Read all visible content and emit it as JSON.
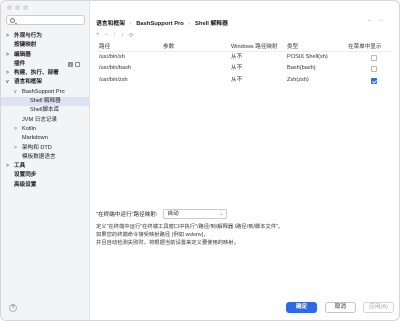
{
  "sidebar": {
    "items": [
      {
        "label": "外观与行为",
        "bold": true,
        "chev": ">"
      },
      {
        "label": "按键映射",
        "bold": true,
        "chev": ""
      },
      {
        "label": "编辑器",
        "bold": true,
        "chev": ">"
      },
      {
        "label": "插件",
        "bold": true,
        "chev": ""
      },
      {
        "label": "构建、执行、部署",
        "bold": true,
        "chev": ">"
      },
      {
        "label": "语言和框架",
        "bold": true,
        "chev": "v"
      },
      {
        "label": "BashSupport Pro",
        "bold": false,
        "chev": "v"
      },
      {
        "label": "Shell 解释器",
        "bold": false,
        "chev": ""
      },
      {
        "label": "Shell脚本库",
        "bold": false,
        "chev": ""
      },
      {
        "label": "JVM 日志记录",
        "bold": false,
        "chev": ""
      },
      {
        "label": "Kotlin",
        "bold": false,
        "chev": ">"
      },
      {
        "label": "Markdown",
        "bold": false,
        "chev": ""
      },
      {
        "label": "架构和 DTD",
        "bold": false,
        "chev": ">"
      },
      {
        "label": "模板数据语言",
        "bold": false,
        "chev": ""
      },
      {
        "label": "工具",
        "bold": true,
        "chev": ">"
      },
      {
        "label": "设置同步",
        "bold": true,
        "chev": ""
      },
      {
        "label": "高级设置",
        "bold": true,
        "chev": ""
      }
    ],
    "help": "?"
  },
  "breadcrumb": {
    "a": "语言和框架",
    "b": "BashSupport Pro",
    "c": "Shell 解释器",
    "sep": "›"
  },
  "toolbar": {
    "icons": [
      "add-icon",
      "remove-icon",
      "move-up-icon",
      "move-down-icon",
      "refresh-icon"
    ]
  },
  "table": {
    "headers": [
      "路径",
      "参数",
      "Windows 路径映射",
      "类型",
      "在菜单中显示"
    ],
    "rows": [
      {
        "path": "/usr/bin/sh",
        "args": "",
        "mapping": "从不",
        "type": "POSIX Shell(sh)",
        "show": false
      },
      {
        "path": "/usr/bin/bash",
        "args": "",
        "mapping": "从不",
        "type": "Bash(bash)",
        "show": false
      },
      {
        "path": "/usr/bin/zsh",
        "args": "",
        "mapping": "从不",
        "type": "Zsh(zsh)",
        "show": true
      }
    ]
  },
  "mapping": {
    "label": "\"在终端中运行\"路径映射:",
    "value": "自动"
  },
  "description": {
    "line1": "定义\"在终端中运行\"在终端工具窗口中执行\"/路径/到/解释器 /路径/到/脚本文件\"。",
    "line2": "如果您的终端命令接受映射路径 (例如 wslenv)，",
    "line3": "并且自动检测失败时，将根据当前设置来定义要使用的映射。"
  },
  "footer": {
    "ok": "确定",
    "cancel": "取消",
    "apply": "应用(A)"
  },
  "colors": {
    "accent": "#2f6ae5",
    "selection": "#dbe3f5"
  }
}
